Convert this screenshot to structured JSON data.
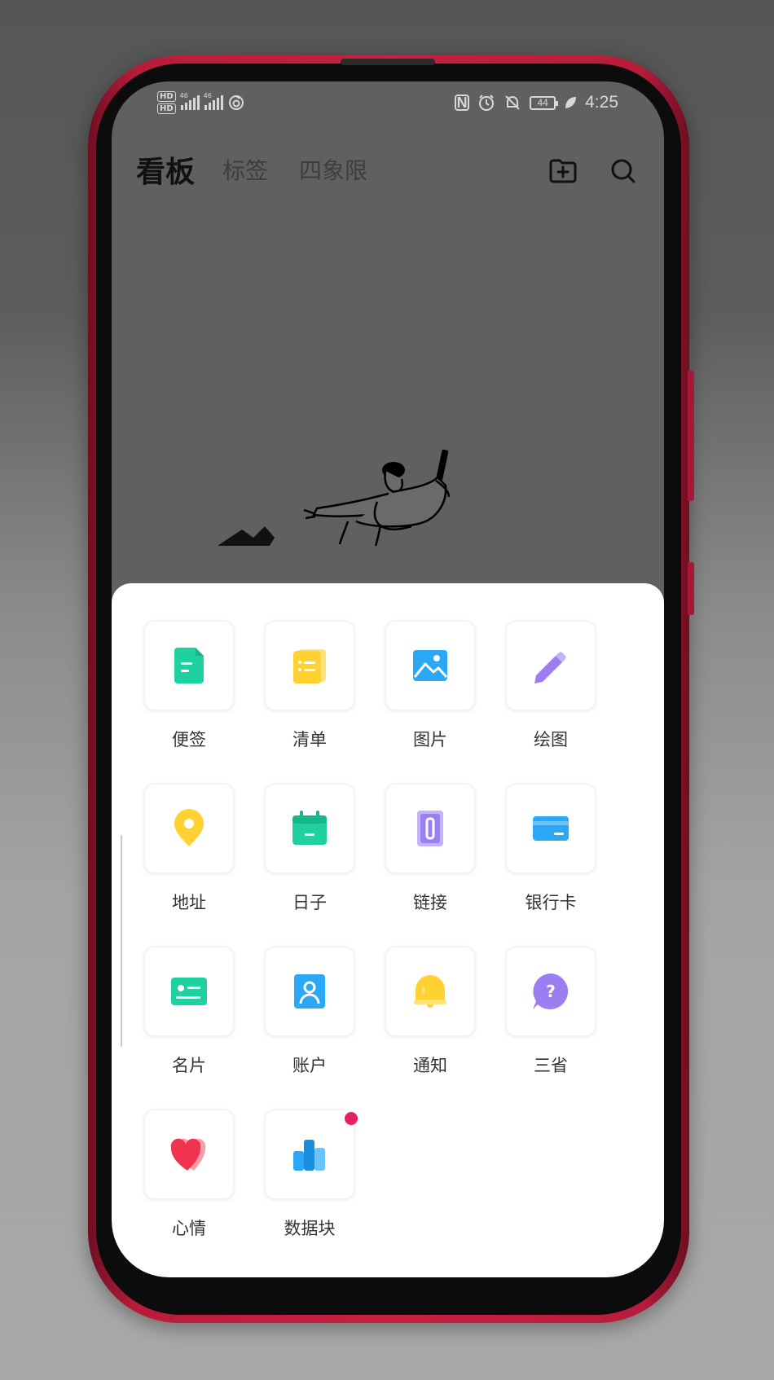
{
  "status_bar": {
    "hd1": "HD",
    "hd2": "HD",
    "net1": "46",
    "net2": "46",
    "battery": "44",
    "time": "4:25",
    "icons": [
      "nfc-icon",
      "alarm-icon",
      "mute-bell-icon",
      "battery-icon",
      "power-saving-leaf-icon"
    ]
  },
  "header": {
    "tabs": [
      {
        "label": "看板",
        "active": true
      },
      {
        "label": "标签",
        "active": false
      },
      {
        "label": "四象限",
        "active": false
      }
    ],
    "actions": [
      "new-folder-icon",
      "search-icon"
    ]
  },
  "sheet": {
    "items": [
      {
        "label": "便签",
        "icon": "note-icon",
        "color": "#1fd1a1"
      },
      {
        "label": "清单",
        "icon": "checklist-icon",
        "color": "#ffd231"
      },
      {
        "label": "图片",
        "icon": "image-icon",
        "color": "#2aa7f5"
      },
      {
        "label": "绘图",
        "icon": "pencil-icon",
        "color": "#9b7ff2"
      },
      {
        "label": "地址",
        "icon": "location-pin-icon",
        "color": "#ffd231"
      },
      {
        "label": "日子",
        "icon": "calendar-icon",
        "color": "#1fd1a1"
      },
      {
        "label": "链接",
        "icon": "link-icon",
        "color": "#9b7ff2"
      },
      {
        "label": "银行卡",
        "icon": "bank-card-icon",
        "color": "#2aa7f5"
      },
      {
        "label": "名片",
        "icon": "business-card-icon",
        "color": "#1fd1a1"
      },
      {
        "label": "账户",
        "icon": "account-icon",
        "color": "#2aa7f5"
      },
      {
        "label": "通知",
        "icon": "bell-icon",
        "color": "#ffd231"
      },
      {
        "label": "三省",
        "icon": "question-bubble-icon",
        "color": "#9b7ff2"
      },
      {
        "label": "心情",
        "icon": "heart-icon",
        "color": "#f0334e"
      },
      {
        "label": "数据块",
        "icon": "bar-chart-icon",
        "color": "#2aa7f5",
        "badge": true
      }
    ]
  }
}
